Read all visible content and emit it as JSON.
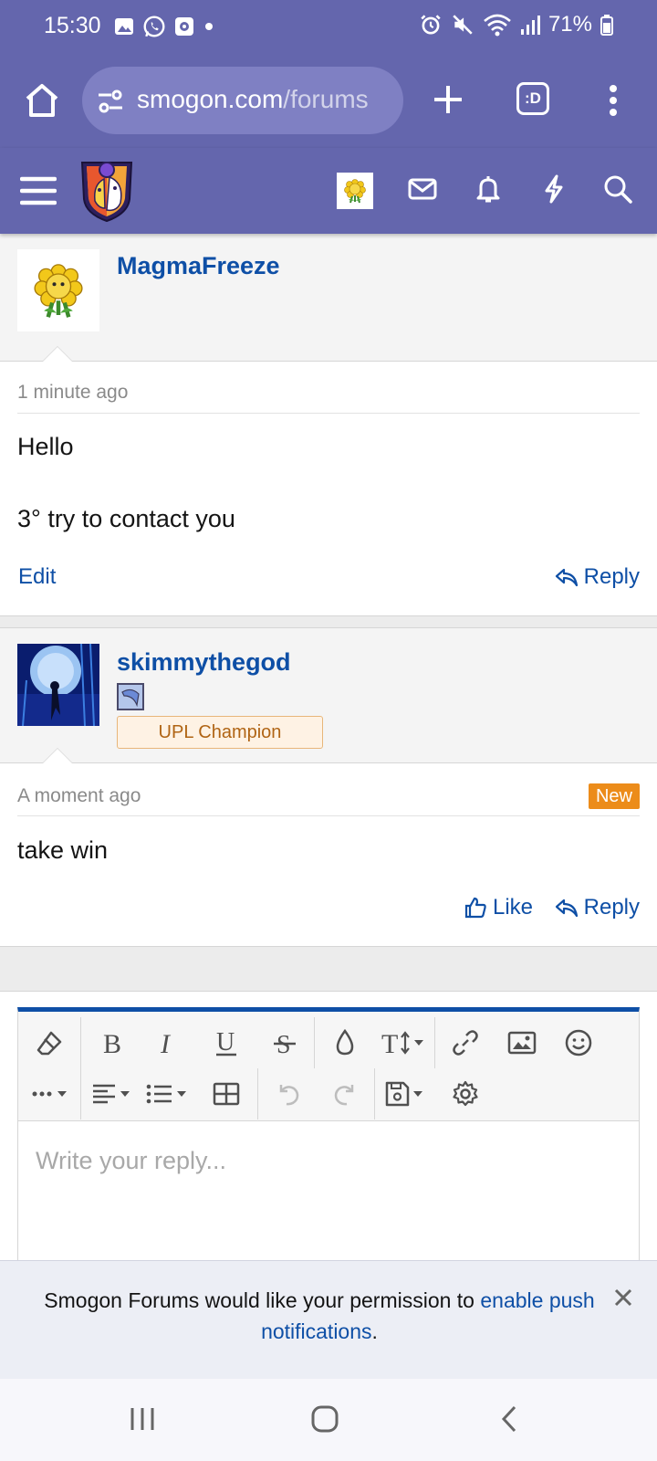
{
  "status_bar": {
    "time": "15:30",
    "battery": "71%"
  },
  "browser": {
    "url_host": "smogon.com",
    "url_path": "/forums",
    "tabs_label": ":D"
  },
  "posts": [
    {
      "username": "MagmaFreeze",
      "time": "1 minute ago",
      "lines": [
        "Hello",
        "3° try to contact you"
      ],
      "edit_label": "Edit",
      "reply_label": "Reply"
    },
    {
      "username": "skimmythegod",
      "user_title": "UPL Champion",
      "time": "A moment ago",
      "badge": "New",
      "lines": [
        "take win"
      ],
      "like_label": "Like",
      "reply_label": "Reply"
    }
  ],
  "editor": {
    "placeholder": "Write your reply..."
  },
  "notice": {
    "text_before": "Smogon Forums would like your permission to ",
    "link_text": "enable push notifications",
    "text_after": "."
  },
  "colors": {
    "header": "#6466ad",
    "link": "#0e4fa6",
    "new_badge": "#ec8c1a"
  }
}
